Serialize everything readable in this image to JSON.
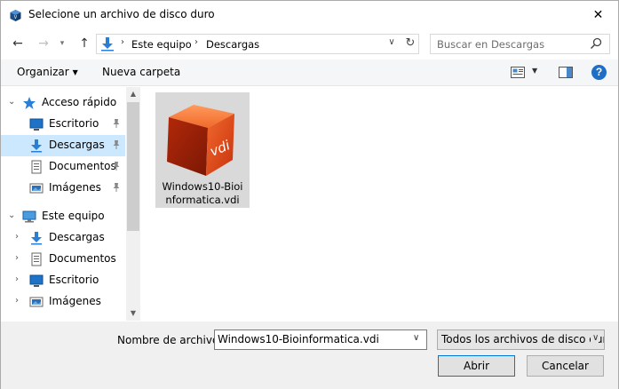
{
  "window": {
    "title": "Selecione un archivo de disco duro",
    "close_glyph": "✕"
  },
  "nav": {
    "back_glyph": "←",
    "forward_glyph": "→",
    "recent_glyph": "▾",
    "up_glyph": "↑"
  },
  "address": {
    "segments": [
      "Este equipo",
      "Descargas"
    ],
    "separator_glyph": "›",
    "dropdown_glyph": "∨",
    "refresh_glyph": "↻"
  },
  "search": {
    "placeholder": "Buscar en Descargas"
  },
  "toolbar": {
    "organize_label": "Organizar",
    "caret_glyph": "▼",
    "new_folder_label": "Nueva carpeta",
    "help_label": "?"
  },
  "sidebar": {
    "expander_open": "⌄",
    "expander_closed": "›",
    "items": [
      {
        "label": "Acceso rápido",
        "icon": "star-icon",
        "expander": "open",
        "pinned": false,
        "selected": false
      },
      {
        "label": "Escritorio",
        "icon": "desktop-icon",
        "expander": "",
        "pinned": true,
        "selected": false
      },
      {
        "label": "Descargas",
        "icon": "download-icon",
        "expander": "",
        "pinned": true,
        "selected": true
      },
      {
        "label": "Documentos",
        "icon": "document-icon",
        "expander": "",
        "pinned": true,
        "selected": false
      },
      {
        "label": "Imágenes",
        "icon": "pictures-icon",
        "expander": "",
        "pinned": true,
        "selected": false
      },
      {
        "label": "Este equipo",
        "icon": "computer-icon",
        "expander": "open",
        "pinned": false,
        "selected": false
      },
      {
        "label": "Descargas",
        "icon": "download-icon",
        "expander": "closed",
        "pinned": false,
        "selected": false
      },
      {
        "label": "Documentos",
        "icon": "document-icon",
        "expander": "closed",
        "pinned": false,
        "selected": false
      },
      {
        "label": "Escritorio",
        "icon": "desktop-icon",
        "expander": "closed",
        "pinned": false,
        "selected": false
      },
      {
        "label": "Imágenes",
        "icon": "pictures-icon",
        "expander": "closed",
        "pinned": false,
        "selected": false
      }
    ],
    "scroll_up_glyph": "▲",
    "scroll_down_glyph": "▼"
  },
  "files": [
    {
      "name_line1": "Windows10-Bioi",
      "name_line2": "nformatica.vdi",
      "icon": "vdi-disk-icon",
      "icon_text": "vdi"
    }
  ],
  "bottom": {
    "filename_label": "Nombre de archivo:",
    "filename_value": "Windows10-Bioinformatica.vdi",
    "filename_caret": "∨",
    "filter_value": "Todos los archivos de disco duro",
    "filter_caret": "∨",
    "open_label": "Abrir",
    "cancel_label": "Cancelar"
  },
  "colors": {
    "selection": "#cce8ff",
    "accent": "#0078d7",
    "vdi_orange": "#e8501d"
  }
}
